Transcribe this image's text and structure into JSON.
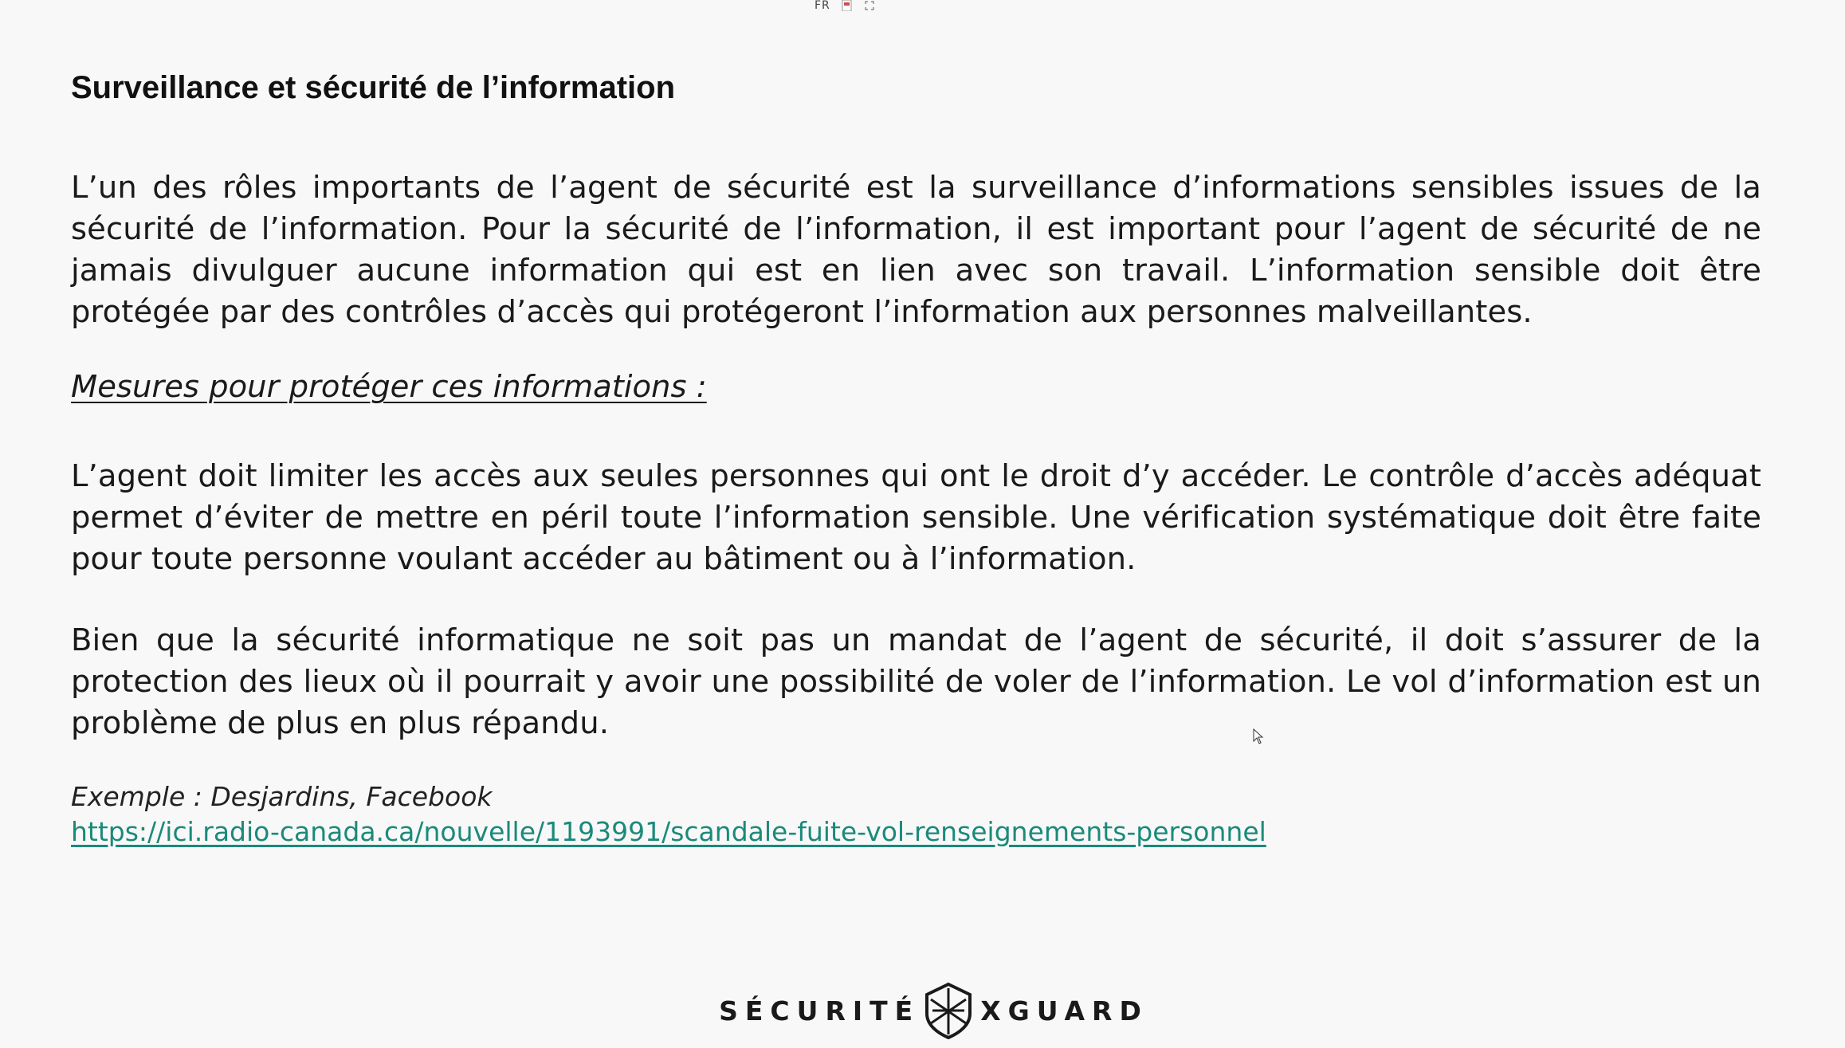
{
  "toolbar": {
    "language": "FR"
  },
  "document": {
    "title": "Surveillance et sécurité de l’information",
    "paragraph_1": "L’un des rôles importants de l’agent de sécurité est la surveillance d’informations sensibles issues de la sécurité de l’information. Pour la sécurité de l’information, il est important pour l’agent de sécurité de ne jamais divulguer aucune information qui est en lien avec son travail. L’information sensible doit être protégée par des contrôles d’accès qui protégeront l’information aux personnes malveillantes.",
    "subtitle": "Mesures pour protéger ces informations :",
    "paragraph_2": "L’agent doit limiter les accès aux seules personnes qui ont le droit d’y accéder. Le contrôle d’accès adéquat permet d’éviter de mettre en péril toute l’information sensible. Une vérification systématique doit être faite pour toute personne voulant accéder au bâtiment ou à l’information.",
    "paragraph_3": "Bien que la sécurité informatique ne soit pas un mandat de l’agent de sécurité, il doit s’assurer de la protection des lieux où il pourrait y avoir une possibilité de voler de l’information. Le vol d’information est un problème de plus en plus répandu.",
    "example": "Exemple : Desjardins, Facebook",
    "link": "https://ici.radio-canada.ca/nouvelle/1193991/scandale-fuite-vol-renseignements-personnel"
  },
  "footer": {
    "brand_left": "SÉCURITÉ",
    "brand_right": "XGUARD"
  },
  "colors": {
    "background": "#f8f8f8",
    "text": "#1a1a1a",
    "link": "#1a8a7a"
  }
}
